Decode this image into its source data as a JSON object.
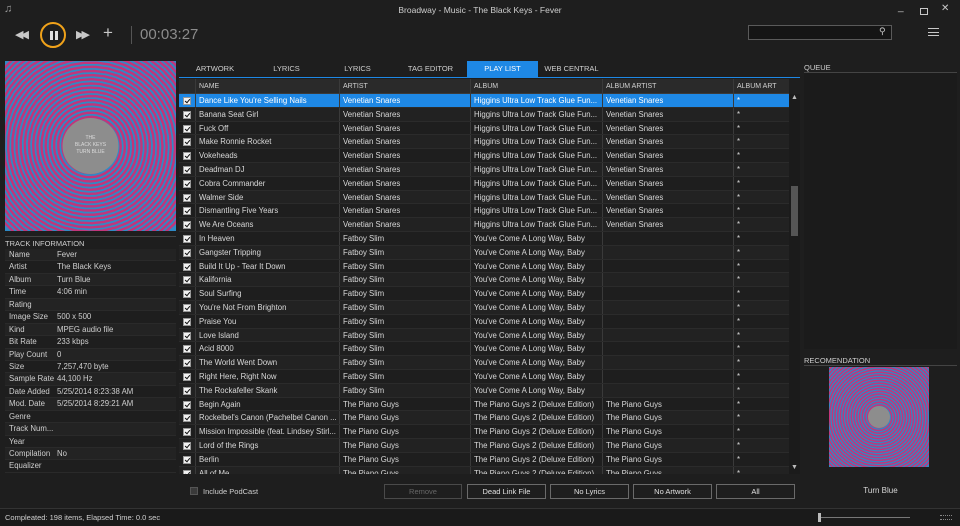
{
  "window": {
    "title": "Broadway - Music - The Black Keys - Fever"
  },
  "transport": {
    "elapsed": "00:03:27",
    "search_value": ""
  },
  "album_art": {
    "cover_text_line1": "THE",
    "cover_text_line2": "BLACK KEYS",
    "cover_text_line3": "TURN BLUE"
  },
  "track_info": {
    "header": "TRACK INFORMATION",
    "rows": [
      {
        "key": "Name",
        "value": "Fever"
      },
      {
        "key": "Artist",
        "value": "The Black Keys"
      },
      {
        "key": "Album",
        "value": "Turn Blue"
      },
      {
        "key": "Time",
        "value": "4:06 min"
      },
      {
        "key": "Rating",
        "value": ""
      },
      {
        "key": "Image Size",
        "value": "500 x 500"
      },
      {
        "key": "Kind",
        "value": "MPEG audio file"
      },
      {
        "key": "Bit Rate",
        "value": "233 kbps"
      },
      {
        "key": "Play Count",
        "value": "0"
      },
      {
        "key": "Size",
        "value": "7,257,470 byte"
      },
      {
        "key": "Sample Rate",
        "value": "44,100 Hz"
      },
      {
        "key": "Date Added",
        "value": "5/25/2014 8:23:38 AM"
      },
      {
        "key": "Mod. Date",
        "value": "5/25/2014 8:29:21 AM"
      },
      {
        "key": "Genre",
        "value": ""
      },
      {
        "key": "Track Num...",
        "value": ""
      },
      {
        "key": "Year",
        "value": ""
      },
      {
        "key": "Compilation",
        "value": "No"
      },
      {
        "key": "Equalizer",
        "value": ""
      }
    ]
  },
  "tabs": [
    {
      "label": "ARTWORK SEARCH",
      "active": false
    },
    {
      "label": "LYRICS SEARCH",
      "active": false
    },
    {
      "label": "LYRICS VIEWER",
      "active": false
    },
    {
      "label": "TAG EDITOR",
      "active": false
    },
    {
      "label": "PLAY LIST",
      "active": true
    },
    {
      "label": "WEB CENTRAL",
      "active": false
    }
  ],
  "grid": {
    "columns": [
      "NAME",
      "ARTIST",
      "ALBUM",
      "ALBUM ARTIST",
      "ALBUM ART"
    ],
    "rows": [
      {
        "name": "Dance Like You're Selling Nails",
        "artist": "Venetian Snares",
        "album": "Higgins Ultra Low Track Glue Fun...",
        "album_artist": "Venetian Snares",
        "art": "*",
        "selected": true
      },
      {
        "name": "Banana Seat Girl",
        "artist": "Venetian Snares",
        "album": "Higgins Ultra Low Track Glue Fun...",
        "album_artist": "Venetian Snares",
        "art": "*"
      },
      {
        "name": "Fuck Off",
        "artist": "Venetian Snares",
        "album": "Higgins Ultra Low Track Glue Fun...",
        "album_artist": "Venetian Snares",
        "art": "*"
      },
      {
        "name": "Make Ronnie Rocket",
        "artist": "Venetian Snares",
        "album": "Higgins Ultra Low Track Glue Fun...",
        "album_artist": "Venetian Snares",
        "art": "*"
      },
      {
        "name": "Vokeheads",
        "artist": "Venetian Snares",
        "album": "Higgins Ultra Low Track Glue Fun...",
        "album_artist": "Venetian Snares",
        "art": "*"
      },
      {
        "name": "Deadman DJ",
        "artist": "Venetian Snares",
        "album": "Higgins Ultra Low Track Glue Fun...",
        "album_artist": "Venetian Snares",
        "art": "*"
      },
      {
        "name": "Cobra Commander",
        "artist": "Venetian Snares",
        "album": "Higgins Ultra Low Track Glue Fun...",
        "album_artist": "Venetian Snares",
        "art": "*"
      },
      {
        "name": "Walmer Side",
        "artist": "Venetian Snares",
        "album": "Higgins Ultra Low Track Glue Fun...",
        "album_artist": "Venetian Snares",
        "art": "*"
      },
      {
        "name": "Dismantling Five Years",
        "artist": "Venetian Snares",
        "album": "Higgins Ultra Low Track Glue Fun...",
        "album_artist": "Venetian Snares",
        "art": "*"
      },
      {
        "name": "We Are Oceans",
        "artist": "Venetian Snares",
        "album": "Higgins Ultra Low Track Glue Fun...",
        "album_artist": "Venetian Snares",
        "art": "*"
      },
      {
        "name": "In Heaven",
        "artist": "Fatboy Slim",
        "album": "You've Come A Long Way, Baby",
        "album_artist": "",
        "art": "*"
      },
      {
        "name": "Gangster Tripping",
        "artist": "Fatboy Slim",
        "album": "You've Come A Long Way, Baby",
        "album_artist": "",
        "art": "*"
      },
      {
        "name": "Build It Up - Tear It Down",
        "artist": "Fatboy Slim",
        "album": "You've Come A Long Way, Baby",
        "album_artist": "",
        "art": "*"
      },
      {
        "name": "Kalifornia",
        "artist": "Fatboy Slim",
        "album": "You've Come A Long Way, Baby",
        "album_artist": "",
        "art": "*"
      },
      {
        "name": "Soul Surfing",
        "artist": "Fatboy Slim",
        "album": "You've Come A Long Way, Baby",
        "album_artist": "",
        "art": "*"
      },
      {
        "name": "You're Not From Brighton",
        "artist": "Fatboy Slim",
        "album": "You've Come A Long Way, Baby",
        "album_artist": "",
        "art": "*"
      },
      {
        "name": "Praise You",
        "artist": "Fatboy Slim",
        "album": "You've Come A Long Way, Baby",
        "album_artist": "",
        "art": "*"
      },
      {
        "name": "Love Island",
        "artist": "Fatboy Slim",
        "album": "You've Come A Long Way, Baby",
        "album_artist": "",
        "art": "*"
      },
      {
        "name": "Acid 8000",
        "artist": "Fatboy Slim",
        "album": "You've Come A Long Way, Baby",
        "album_artist": "",
        "art": "*"
      },
      {
        "name": "The World Went Down",
        "artist": "Fatboy Slim",
        "album": "You've Come A Long Way, Baby",
        "album_artist": "",
        "art": "*"
      },
      {
        "name": "Right Here, Right Now",
        "artist": "Fatboy Slim",
        "album": "You've Come A Long Way, Baby",
        "album_artist": "",
        "art": "*"
      },
      {
        "name": "The Rockafeller Skank",
        "artist": "Fatboy Slim",
        "album": "You've Come A Long Way, Baby",
        "album_artist": "",
        "art": "*"
      },
      {
        "name": "Begin Again",
        "artist": "The Piano Guys",
        "album": "The Piano Guys 2 (Deluxe Edition)",
        "album_artist": "The Piano Guys",
        "art": "*"
      },
      {
        "name": "Rockelbel's Canon (Pachelbel Canon ...",
        "artist": "The Piano Guys",
        "album": "The Piano Guys 2 (Deluxe Edition)",
        "album_artist": "The Piano Guys",
        "art": "*"
      },
      {
        "name": "Mission Impossible (feat. Lindsey Stirl...",
        "artist": "The Piano Guys",
        "album": "The Piano Guys 2 (Deluxe Edition)",
        "album_artist": "The Piano Guys",
        "art": "*"
      },
      {
        "name": "Lord of the Rings",
        "artist": "The Piano Guys",
        "album": "The Piano Guys 2 (Deluxe Edition)",
        "album_artist": "The Piano Guys",
        "art": "*"
      },
      {
        "name": "Berlin",
        "artist": "The Piano Guys",
        "album": "The Piano Guys 2 (Deluxe Edition)",
        "album_artist": "The Piano Guys",
        "art": "*"
      },
      {
        "name": "All of Me",
        "artist": "The Piano Guys",
        "album": "The Piano Guys 2 (Deluxe Edition)",
        "album_artist": "The Piano Guys",
        "art": "*"
      }
    ]
  },
  "bottom": {
    "podcast_label": "Include PodCast",
    "buttons": [
      "Remove",
      "Dead Link File",
      "No Lyrics",
      "No Artwork",
      "All"
    ]
  },
  "right_panel": {
    "queue_label": "QUEUE",
    "recommendation_label": "RECOMENDATION",
    "recommendation_title": "Turn Blue"
  },
  "status": {
    "text": "Compleated: 198 items,  Elapsed Time: 0.0 sec"
  },
  "colors": {
    "accent": "#1e88e5",
    "play_ring": "#f0a21a",
    "cover_blue": "#2f8ac6",
    "cover_pink": "#c2357a"
  }
}
